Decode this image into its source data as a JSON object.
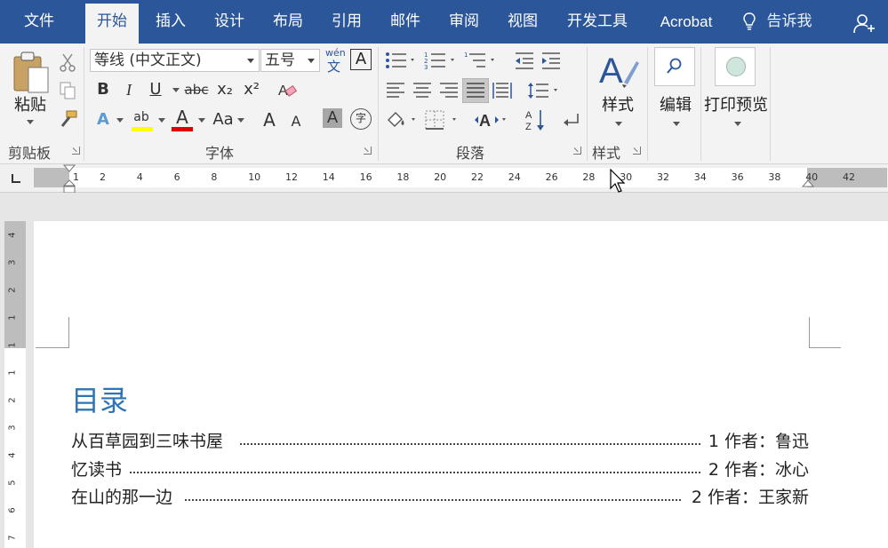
{
  "menu": {
    "tabs": [
      "文件",
      "开始",
      "插入",
      "设计",
      "布局",
      "引用",
      "邮件",
      "审阅",
      "视图",
      "开发工具",
      "Acrobat"
    ],
    "active_index": 1,
    "tell_me": "告诉我"
  },
  "ribbon": {
    "clipboard": {
      "paste_label": "粘贴",
      "group_label": "剪贴板"
    },
    "font": {
      "font_name": "等线 (中文正文)",
      "font_size": "五号",
      "phonetic_top": "wén",
      "phonetic_bottom": "文",
      "boxed_char": "A",
      "bold": "B",
      "italic": "I",
      "underline": "U",
      "strikethrough": "abc",
      "subscript": "x₂",
      "superscript": "x²",
      "text_effects": "A",
      "highlight": "ab",
      "font_color": "A",
      "change_case": "Aa",
      "grow_font": "A",
      "shrink_font": "A",
      "char_shading": "A",
      "enclose_char": "字",
      "group_label": "字体",
      "highlight_color": "#ffff00",
      "font_color_value": "#e00000"
    },
    "paragraph": {
      "group_label": "段落"
    },
    "styles": {
      "label": "样式",
      "group_label": "样式"
    },
    "editing": {
      "label": "编辑"
    },
    "print_preview": {
      "label": "打印预览"
    }
  },
  "ruler": {
    "numbers": [
      "1",
      "2",
      "4",
      "6",
      "8",
      "10",
      "12",
      "14",
      "16",
      "18",
      "20",
      "22",
      "24",
      "26",
      "28",
      "30",
      "32",
      "34",
      "36",
      "38",
      "40",
      "42"
    ]
  },
  "vruler": {
    "numbers": [
      "4",
      "3",
      "2",
      "1",
      "1",
      "1",
      "2",
      "3",
      "4",
      "5",
      "6",
      "7"
    ]
  },
  "document": {
    "toc_title": "目录",
    "toc_entries": [
      {
        "title": "从百草园到三味书屋",
        "page_text": "1 作者：鲁迅"
      },
      {
        "title": "忆读书",
        "page_text": "2 作者：冰心"
      },
      {
        "title": "在山的那一边",
        "page_text": "2 作者：王家新"
      }
    ]
  },
  "colors": {
    "menu_bg": "#2b579a",
    "ribbon_bg": "#f3f3f3",
    "heading": "#2e74b5"
  }
}
